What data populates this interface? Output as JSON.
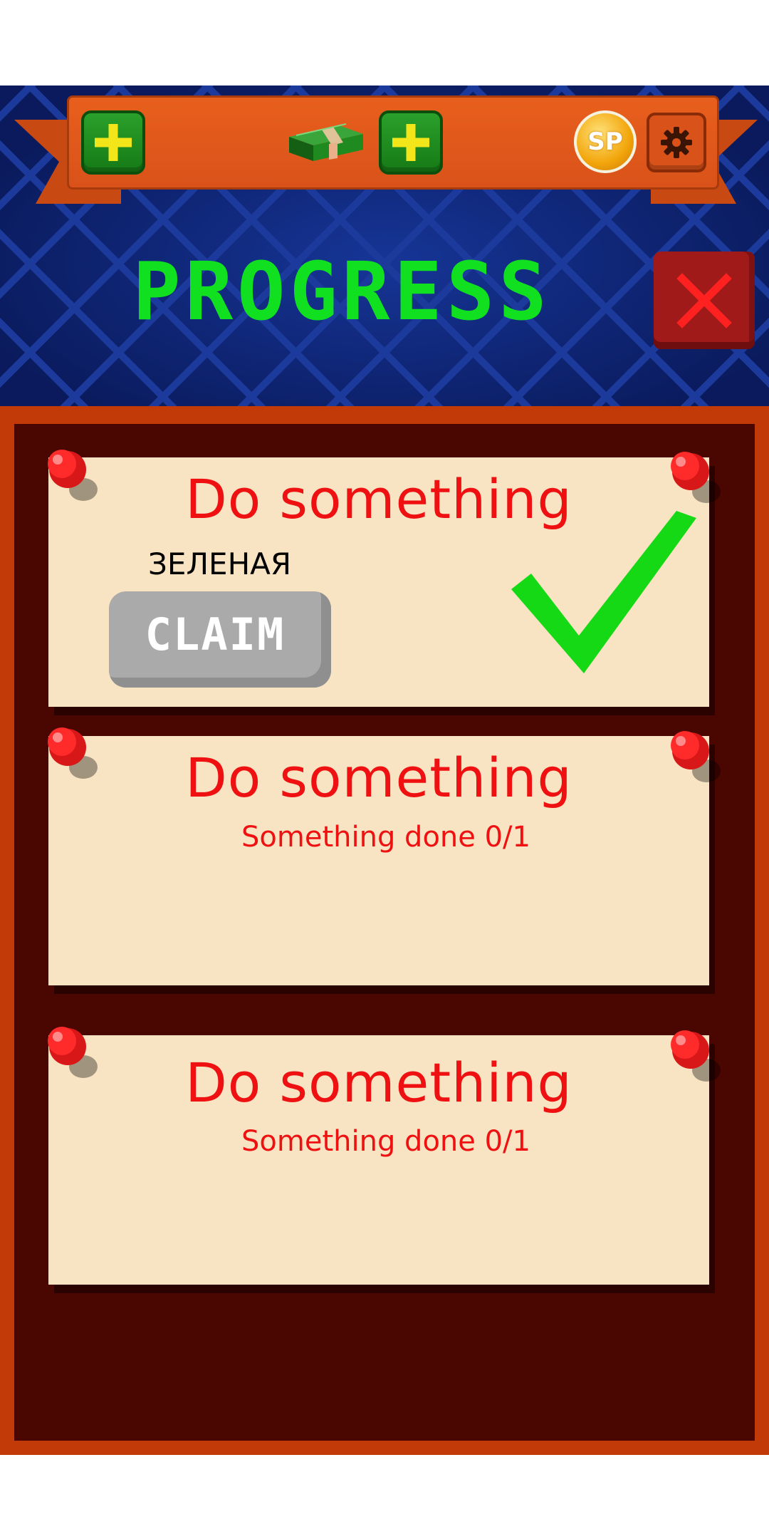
{
  "header": {
    "title": "PROGRESS",
    "add_cash_left": "+",
    "add_cash_right": "+",
    "coin_label": "SP"
  },
  "colors": {
    "title": "#11e020",
    "task_text": "#ef1111",
    "card_background": "#f8e3c2",
    "board": "#4a0600",
    "ribbon": "#d9521a"
  },
  "icons": {
    "cash": "cash-stack-icon",
    "coin": "sp-coin-icon",
    "settings": "gear-icon",
    "close": "close-icon",
    "completed": "checkmark-icon",
    "pin": "push-pin-icon"
  },
  "tasks": [
    {
      "title": "Do something",
      "status": "completed",
      "label": "ЗЕЛЕНАЯ",
      "claim_label": "CLAIM"
    },
    {
      "title": "Do something",
      "progress_text": "Something done 0/1",
      "status": "in_progress"
    },
    {
      "title": "Do something",
      "progress_text": "Something done 0/1",
      "status": "in_progress"
    }
  ]
}
